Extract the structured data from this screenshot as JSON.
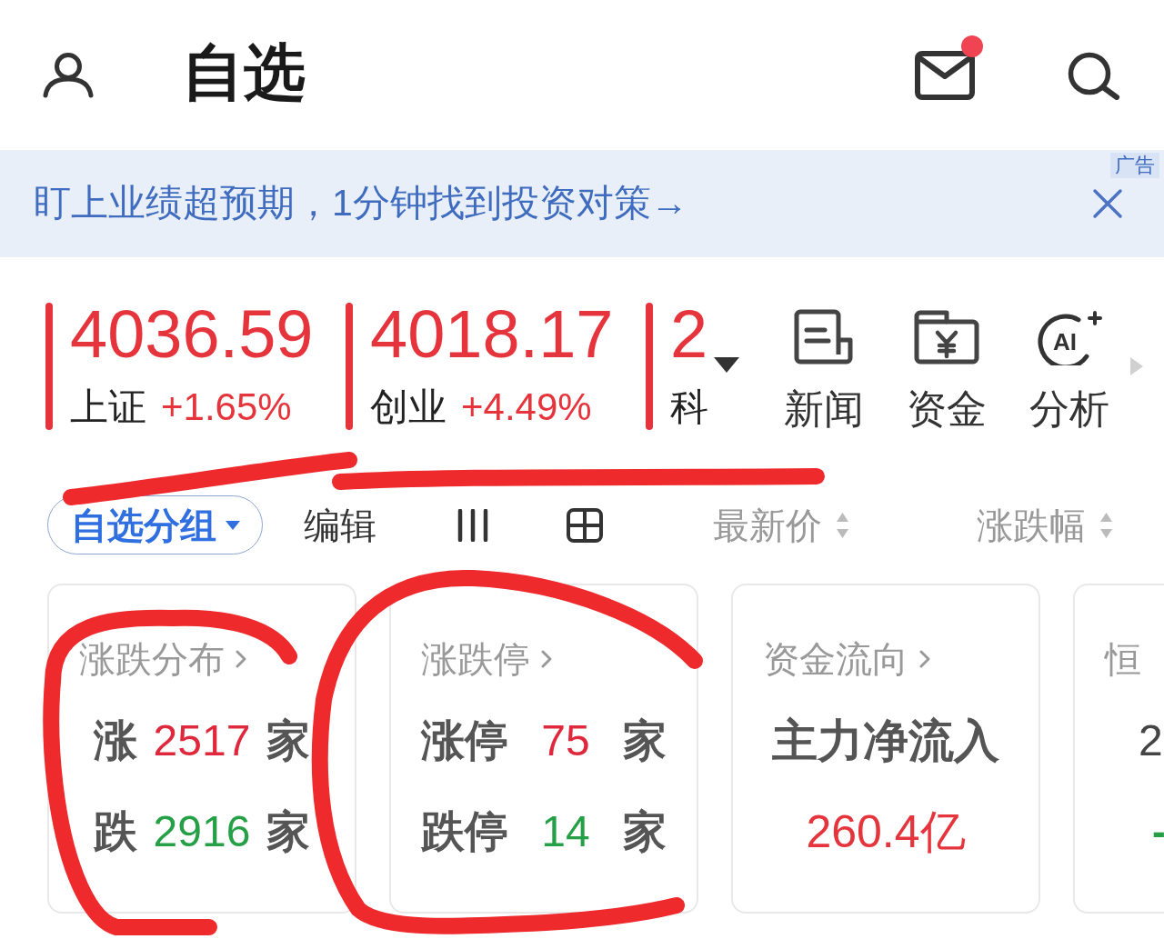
{
  "header": {
    "title": "自选",
    "mail": {
      "unread": true
    }
  },
  "banner": {
    "text": "盯上业绩超预期，1分钟找到投资对策→",
    "tag": "广告"
  },
  "indices": [
    {
      "value": "4036.59",
      "name": "上证",
      "change": "+1.65%"
    },
    {
      "value": "4018.17",
      "name": "创业",
      "change": "+4.49%"
    },
    {
      "value": "2",
      "name": "科"
    }
  ],
  "shortcuts": [
    {
      "label": "新闻"
    },
    {
      "label": "资金"
    },
    {
      "label": "分析",
      "icon_text": "AI"
    }
  ],
  "toolbar": {
    "group": "自选分组",
    "edit": "编辑",
    "sort_columns": [
      {
        "label": "最新价"
      },
      {
        "label": "涨跌幅"
      }
    ]
  },
  "cards": [
    {
      "kind": "counts",
      "title": "涨跌分布",
      "rows": [
        {
          "label": "涨",
          "value": "2517",
          "unit": "家",
          "color": "#e0283c"
        },
        {
          "label": "跌",
          "value": "2916",
          "unit": "家",
          "color": "#26a046"
        }
      ]
    },
    {
      "kind": "counts",
      "title": "涨跌停",
      "rows": [
        {
          "label": "涨停",
          "value": "75",
          "unit": "家",
          "color": "#e0283c"
        },
        {
          "label": "跌停",
          "value": "14",
          "unit": "家",
          "color": "#26a046"
        }
      ]
    },
    {
      "kind": "flow",
      "title": "资金流向",
      "label": "主力净流入",
      "value": "260.4亿",
      "color": "#e5343b"
    },
    {
      "kind": "index",
      "title": "恒",
      "value": "2",
      "change": "-",
      "color": "#26a046"
    }
  ],
  "annotations": [
    {
      "kind": "underline"
    },
    {
      "kind": "underline"
    },
    {
      "kind": "circle"
    },
    {
      "kind": "circle"
    }
  ]
}
